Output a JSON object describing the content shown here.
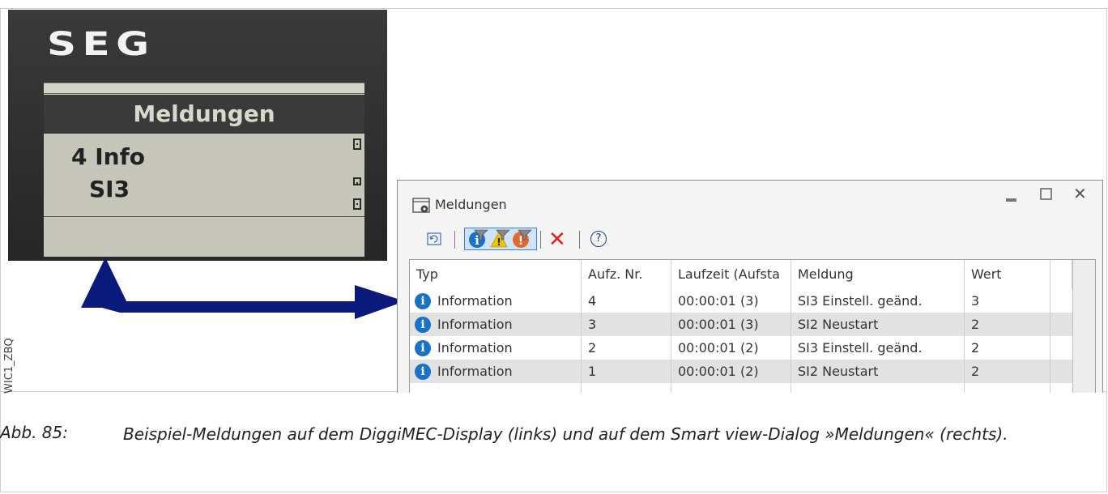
{
  "device": {
    "brand": "SEG",
    "screen_title": "Meldungen",
    "line1": "4 Info",
    "line2": "SI3"
  },
  "side_label": "WIC1_ZBQ",
  "dialog": {
    "title": "Meldungen",
    "window_controls": [
      "minimize-icon",
      "maximize-icon",
      "close-icon"
    ],
    "toolbar": {
      "refresh_icon": "refresh-icon",
      "filter_icons": [
        "info-filter-icon",
        "warning-filter-icon",
        "alarm-filter-icon"
      ],
      "delete_icon": "delete-icon",
      "delete_label": "✕",
      "help_label": "?"
    },
    "columns": [
      "Typ",
      "Aufz. Nr.",
      "Laufzeit (Aufsta",
      "Meldung",
      "Wert"
    ],
    "rows": [
      {
        "typ": "Information",
        "nr": "4",
        "laufzeit": "00:00:01 (3)",
        "meldung": "SI3 Einstell. geänd.",
        "wert": "3"
      },
      {
        "typ": "Information",
        "nr": "3",
        "laufzeit": "00:00:01 (3)",
        "meldung": "SI2 Neustart",
        "wert": "2"
      },
      {
        "typ": "Information",
        "nr": "2",
        "laufzeit": "00:00:01 (2)",
        "meldung": "SI3 Einstell. geänd.",
        "wert": "2"
      },
      {
        "typ": "Information",
        "nr": "1",
        "laufzeit": "00:00:01 (2)",
        "meldung": "SI2 Neustart",
        "wert": "2"
      }
    ]
  },
  "caption": {
    "label": "Abb. 85:",
    "text": "Beispiel-Meldungen auf dem DiggiMEC-Display (links) und auf dem Smart view-Dialog »Meldungen« (rechts)."
  },
  "colors": {
    "arrow": "#0a1a7a",
    "info_icon": "#1a72c7",
    "delete": "#e02020"
  }
}
